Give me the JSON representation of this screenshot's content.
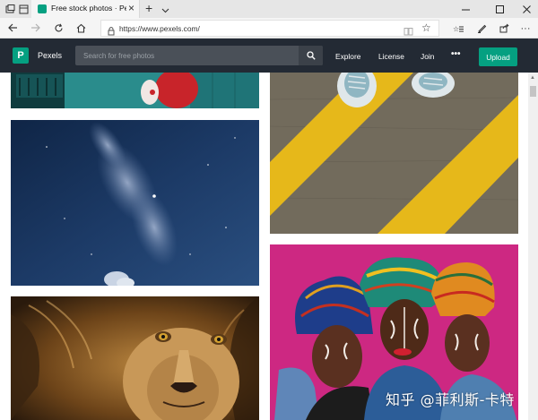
{
  "browser": {
    "tab": {
      "title": "Free stock photos · Pexels"
    },
    "url": "https://www.pexels.com/",
    "icons": {
      "back": "arrow-left-icon",
      "forward": "arrow-right-icon",
      "refresh": "refresh-icon",
      "home": "home-icon",
      "lock": "lock-icon",
      "reading_view": "reading-view-icon",
      "favorite": "star-icon",
      "favorites_hub": "favorites-hub-icon",
      "notes": "pen-icon",
      "share": "share-icon",
      "more": "more-icon"
    }
  },
  "site": {
    "brand": "Pexels",
    "logo_letter": "P",
    "search_placeholder": "Search for free photos",
    "nav": {
      "explore": "Explore",
      "license": "License",
      "join": "Join",
      "more": "•••"
    },
    "upload_label": "Upload",
    "accent": "#05a081",
    "header_bg": "#232a34"
  },
  "photos": [
    {
      "subject": "teal room with person in red"
    },
    {
      "subject": "starry night sky with milky way"
    },
    {
      "subject": "lion face close-up"
    },
    {
      "subject": "sneakers on yellow painted road lines"
    },
    {
      "subject": "three women with painted faces and headwraps"
    }
  ],
  "watermark": "知乎 @菲利斯-卡特"
}
